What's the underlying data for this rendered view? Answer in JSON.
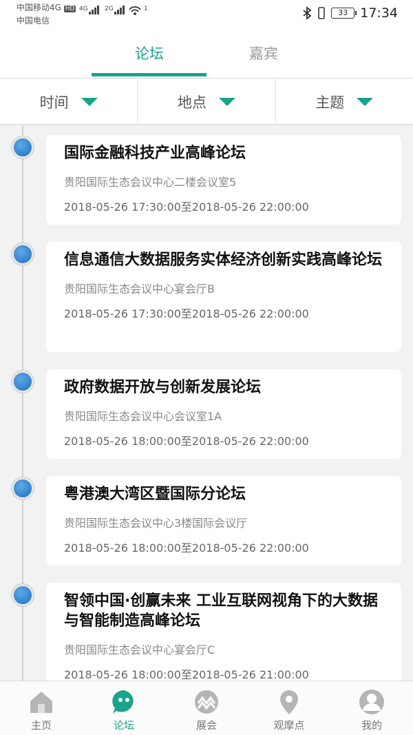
{
  "status_bar": {
    "carrier1": "中国移动4G",
    "carrier1_badge": "HD",
    "carrier2": "中国电信",
    "signal1_label": "4G",
    "signal2_label": "2G",
    "wifi_badge": "1",
    "battery": "33",
    "time": "17:34"
  },
  "tabs": [
    {
      "label": "论坛",
      "active": true
    },
    {
      "label": "嘉宾",
      "active": false
    }
  ],
  "filters": [
    {
      "label": "时间"
    },
    {
      "label": "地点"
    },
    {
      "label": "主题"
    }
  ],
  "forums": [
    {
      "title": "国际金融科技产业高峰论坛",
      "place": "贵阳国际生态会议中心二楼会议室5",
      "time": "2018-05-26 17:30:00至2018-05-26 22:00:00"
    },
    {
      "title": "信息通信大数据服务实体经济创新实践高峰论坛",
      "place": "贵阳国际生态会议中心宴会厅B",
      "time": "2018-05-26 17:30:00至2018-05-26 22:00:00"
    },
    {
      "title": "政府数据开放与创新发展论坛",
      "place": "贵阳国际生态会议中心会议室1A",
      "time": "2018-05-26 18:00:00至2018-05-26 22:00:00"
    },
    {
      "title": "粤港澳大湾区暨国际分论坛",
      "place": "贵阳国际生态会议中心3楼国际会议厅",
      "time": "2018-05-26 18:00:00至2018-05-26 22:00:00"
    },
    {
      "title": "智领中国·创赢未来 工业互联网视角下的大数据与智能制造高峰论坛",
      "place": "贵阳国际生态会议中心宴会厅C",
      "time": "2018-05-26 18:00:00至2018-05-26 21:00:00"
    }
  ],
  "bottom_nav": [
    {
      "label": "主页",
      "icon": "home-icon",
      "active": false
    },
    {
      "label": "论坛",
      "icon": "chat-bubble-icon",
      "active": true
    },
    {
      "label": "展会",
      "icon": "exhibition-icon",
      "active": false
    },
    {
      "label": "观摩点",
      "icon": "location-pin-icon",
      "active": false
    },
    {
      "label": "我的",
      "icon": "user-icon",
      "active": false
    }
  ],
  "colors": {
    "accent": "#1aa38c",
    "dot": "#2a7fd0",
    "inactive_icon": "#b5b5b5"
  }
}
